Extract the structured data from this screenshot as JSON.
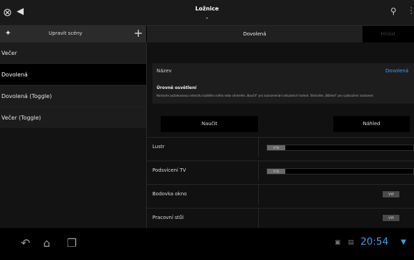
{
  "actionbar": {
    "title": "Ložnice",
    "home_icon": "⊗",
    "back_icon": "◀",
    "chevron": "⌄",
    "bulb_icon": "⚲",
    "overflow_icon": "⋮"
  },
  "left_panel": {
    "header_label": "Upravit scény",
    "pin_icon": "✦",
    "add_icon": "+",
    "items": [
      {
        "label": "Večer"
      },
      {
        "label": "Dovolená"
      },
      {
        "label": "Dovolená (Toggle)"
      },
      {
        "label": "Večer (Toggle)"
      }
    ]
  },
  "tabs": {
    "active": "Dovolená",
    "other": "Hlídat"
  },
  "detail": {
    "name_label": "Název",
    "name_value": "Dovolená",
    "section_title": "Úrovně osvětlení",
    "description": "Nastavte požadovanou intenzitu každého světla nebo stiskněte „Naučit“ pro zaznamenání aktuálních hodnot. Stiskněte „Náhled“ pro vyzkoušení nastavení.",
    "learn_button": "Naučit",
    "preview_button": "Náhled",
    "rows": [
      {
        "label": "Lustr",
        "type": "slider",
        "value_text": "0 %",
        "level": 0
      },
      {
        "label": "Podsvícení TV",
        "type": "slider",
        "value_text": "0 %",
        "level": 0
      },
      {
        "label": "Bodovka okno",
        "type": "toggle",
        "value_text": "VYP"
      },
      {
        "label": "Pracovní stůl",
        "type": "toggle",
        "value_text": "VYP"
      }
    ]
  },
  "navbar": {
    "back_icon": "↶",
    "home_icon": "⌂",
    "recents_icon": "❐",
    "status_icon_1": "▣",
    "status_icon_2": "▤",
    "clock": "20:54",
    "wifi_icon": "▼"
  }
}
